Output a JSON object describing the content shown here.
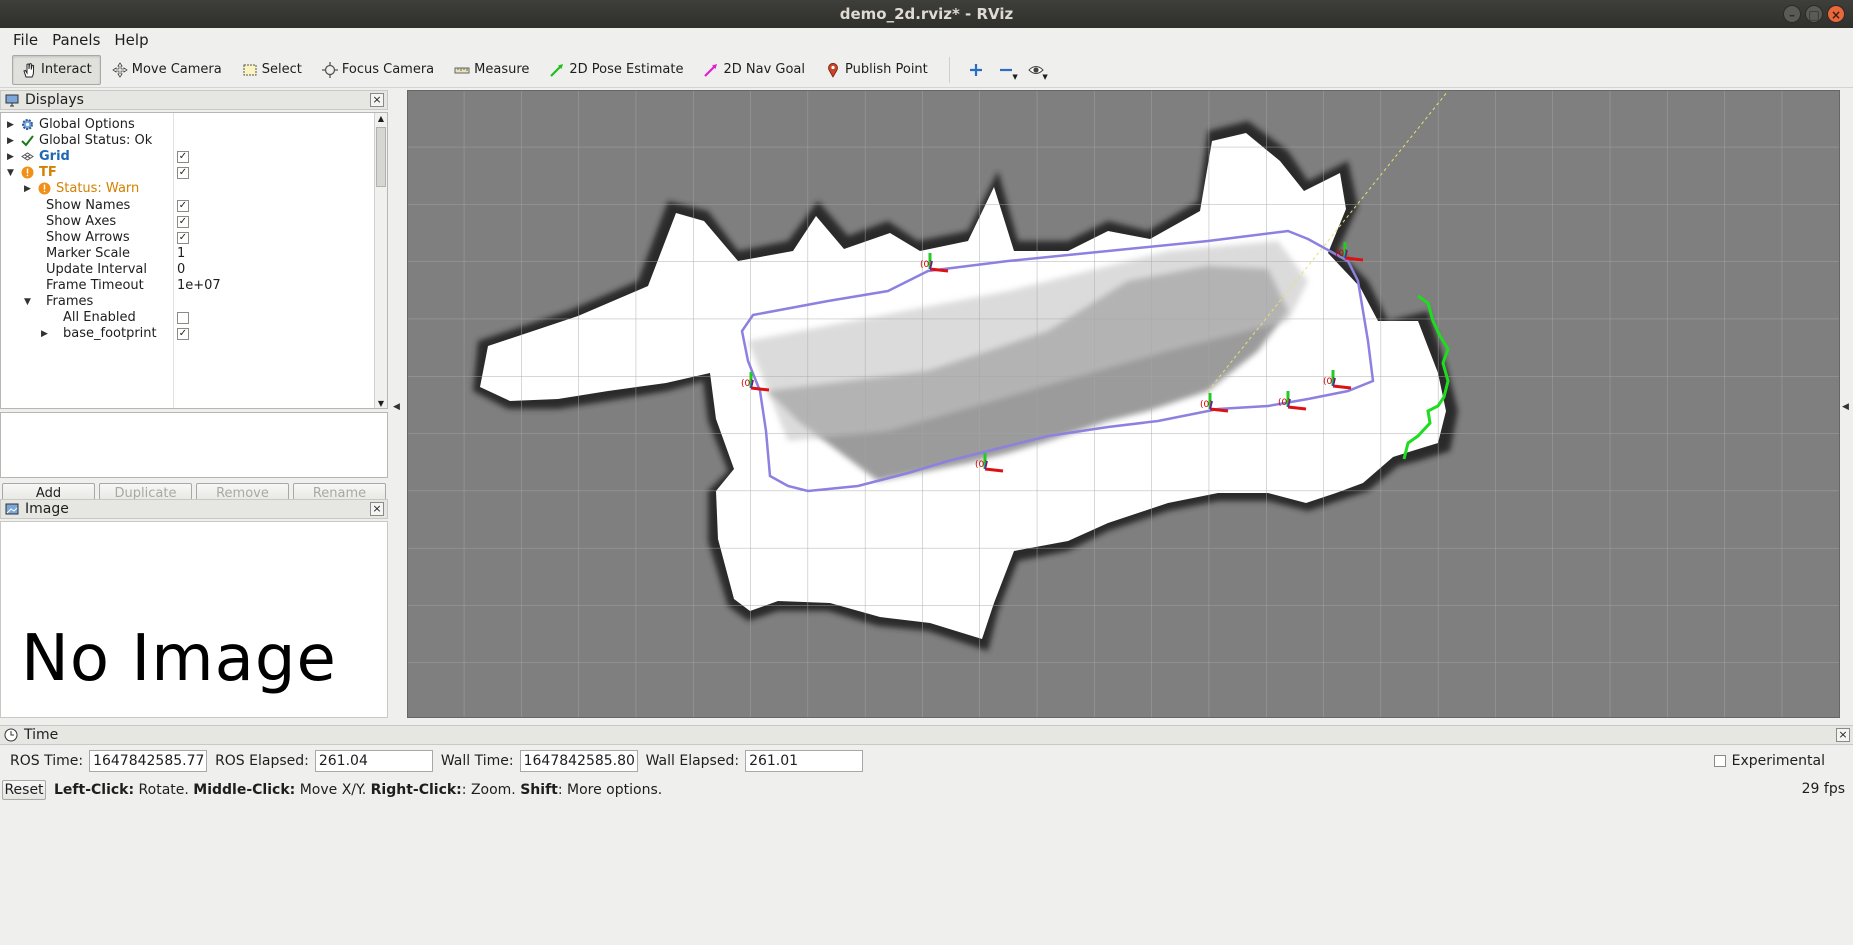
{
  "window": {
    "title": "demo_2d.rviz* - RViz"
  },
  "menu": {
    "items": [
      "File",
      "Panels",
      "Help"
    ]
  },
  "toolbar": {
    "tools": [
      {
        "label": "Interact",
        "icon": "hand-icon",
        "active": true
      },
      {
        "label": "Move Camera",
        "icon": "move-camera-icon",
        "active": false
      },
      {
        "label": "Select",
        "icon": "select-icon",
        "active": false
      },
      {
        "label": "Focus Camera",
        "icon": "focus-camera-icon",
        "active": false
      },
      {
        "label": "Measure",
        "icon": "ruler-icon",
        "active": false
      },
      {
        "label": "2D Pose Estimate",
        "icon": "pose-arrow-green-icon",
        "active": false
      },
      {
        "label": "2D Nav Goal",
        "icon": "nav-goal-arrow-magenta-icon",
        "active": false
      },
      {
        "label": "Publish Point",
        "icon": "map-pin-icon",
        "active": false
      }
    ]
  },
  "displays": {
    "title": "Displays",
    "rows": [
      {
        "indent": 0,
        "arrow": "right",
        "icon": "gear-icon",
        "label": "Global Options",
        "style": "",
        "value": ""
      },
      {
        "indent": 0,
        "arrow": "right",
        "icon": "check-icon",
        "label": "Global Status: Ok",
        "style": "",
        "value": ""
      },
      {
        "indent": 0,
        "arrow": "right",
        "icon": "grid-icon",
        "label": "Grid",
        "style": "blue",
        "checkbox": true
      },
      {
        "indent": 0,
        "arrow": "down",
        "icon": "warning-icon",
        "label": "TF",
        "style": "orange",
        "checkbox": true
      },
      {
        "indent": 1,
        "arrow": "right",
        "icon": "warning-icon",
        "label": "Status: Warn",
        "style": "warn",
        "value": ""
      },
      {
        "indent": 1,
        "arrow": "",
        "icon": "",
        "label": "Show Names",
        "style": "",
        "checkbox": true
      },
      {
        "indent": 1,
        "arrow": "",
        "icon": "",
        "label": "Show Axes",
        "style": "",
        "checkbox": true
      },
      {
        "indent": 1,
        "arrow": "",
        "icon": "",
        "label": "Show Arrows",
        "style": "",
        "checkbox": true
      },
      {
        "indent": 1,
        "arrow": "",
        "icon": "",
        "label": "Marker Scale",
        "style": "",
        "value": "1"
      },
      {
        "indent": 1,
        "arrow": "",
        "icon": "",
        "label": "Update Interval",
        "style": "",
        "value": "0"
      },
      {
        "indent": 1,
        "arrow": "",
        "icon": "",
        "label": "Frame Timeout",
        "style": "",
        "value": "1e+07"
      },
      {
        "indent": 1,
        "arrow": "down",
        "icon": "",
        "label": "Frames",
        "style": "",
        "value": ""
      },
      {
        "indent": 2,
        "arrow": "",
        "icon": "",
        "label": "All Enabled",
        "style": "",
        "checkbox": false
      },
      {
        "indent": 2,
        "arrow": "right",
        "icon": "",
        "label": "base_footprint",
        "style": "",
        "checkbox": true
      }
    ],
    "buttons": [
      {
        "label": "Add",
        "enabled": true
      },
      {
        "label": "Duplicate",
        "enabled": false
      },
      {
        "label": "Remove",
        "enabled": false
      },
      {
        "label": "Rename",
        "enabled": false
      }
    ]
  },
  "image_panel": {
    "title": "Image",
    "placeholder": "No Image"
  },
  "time": {
    "title": "Time",
    "ros_time_label": "ROS Time:",
    "ros_time": "1647842585.77",
    "ros_elapsed_label": "ROS Elapsed:",
    "ros_elapsed": "261.04",
    "wall_time_label": "Wall Time:",
    "wall_time": "1647842585.80",
    "wall_elapsed_label": "Wall Elapsed:",
    "wall_elapsed": "261.01",
    "experimental_label": "Experimental"
  },
  "status": {
    "reset_label": "Reset",
    "hint_parts": [
      {
        "b": "Left-Click:",
        "t": " Rotate. "
      },
      {
        "b": "Middle-Click:",
        "t": " Move X/Y. "
      },
      {
        "b": "Right-Click:",
        "t": ": Zoom. "
      },
      {
        "b": "Shift",
        "t": ": More options."
      }
    ],
    "fps": "29 fps"
  },
  "tf_frame_label": "(0)",
  "colors": {
    "path": "#8c80e0",
    "laser": "#1edc1e",
    "free": "#ffffff",
    "unknown": "#808080"
  }
}
